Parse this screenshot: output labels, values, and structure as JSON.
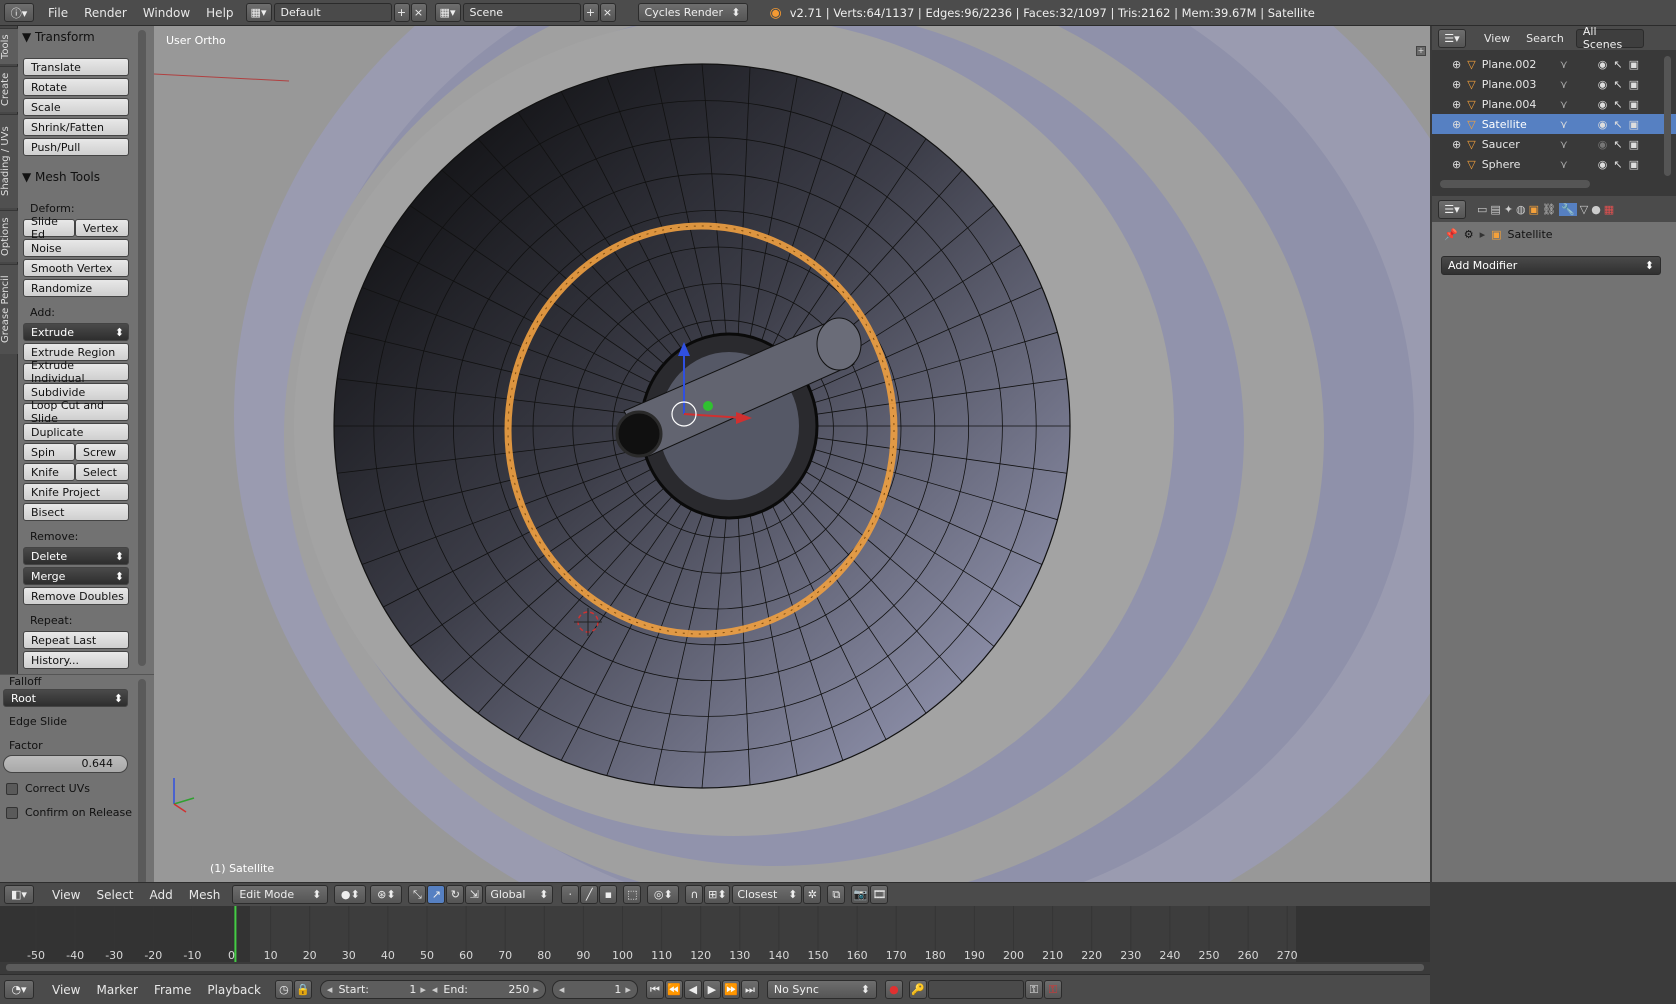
{
  "topbar": {
    "menus": [
      "File",
      "Render",
      "Window",
      "Help"
    ],
    "layout": "Default",
    "scene": "Scene",
    "engine": "Cycles Render",
    "stats": "v2.71 | Verts:64/1137 | Edges:96/2236 | Faces:32/1097 | Tris:2162 | Mem:39.67M | Satellite"
  },
  "tabs": [
    "Tools",
    "Create",
    "Shading / UVs",
    "Options",
    "Grease Pencil"
  ],
  "toolshelf": {
    "transform_title": "Transform",
    "transform": [
      "Translate",
      "Rotate",
      "Scale",
      "Shrink/Fatten",
      "Push/Pull"
    ],
    "meshtools_title": "Mesh Tools",
    "deform_label": "Deform:",
    "slide_edge": "Slide Ed",
    "vertex": "Vertex",
    "noise": "Noise",
    "smooth_vertex": "Smooth Vertex",
    "randomize": "Randomize",
    "add_label": "Add:",
    "extrude": "Extrude",
    "extrude_region": "Extrude Region",
    "extrude_individual": "Extrude Individual",
    "subdivide": "Subdivide",
    "loop_cut": "Loop Cut and Slide",
    "duplicate": "Duplicate",
    "spin": "Spin",
    "screw": "Screw",
    "knife": "Knife",
    "select": "Select",
    "knife_project": "Knife Project",
    "bisect": "Bisect",
    "remove_label": "Remove:",
    "delete": "Delete",
    "merge": "Merge",
    "remove_doubles": "Remove Doubles",
    "repeat_label": "Repeat:",
    "repeat_last": "Repeat Last",
    "history": "History..."
  },
  "operator": {
    "falloff_label": "Falloff",
    "falloff_value": "Root",
    "title": "Edge Slide",
    "factor_label": "Factor",
    "factor_value": "0.644",
    "correct_uvs": "Correct UVs",
    "confirm_release": "Confirm on Release"
  },
  "viewport": {
    "view_label": "User Ortho",
    "object_label": "(1) Satellite"
  },
  "outliner": {
    "view": "View",
    "search": "Search",
    "scenes": "All Scenes",
    "items": [
      "Plane.002",
      "Plane.003",
      "Plane.004",
      "Satellite",
      "Saucer",
      "Sphere"
    ],
    "active": "Satellite"
  },
  "properties": {
    "object_name": "Satellite",
    "add_modifier": "Add Modifier"
  },
  "view3d_header": {
    "view": "View",
    "select": "Select",
    "add": "Add",
    "mesh": "Mesh",
    "mode": "Edit Mode",
    "orientation": "Global",
    "snap": "Closest"
  },
  "timeline": {
    "ticks": [
      -50,
      -40,
      -30,
      -20,
      -10,
      0,
      10,
      20,
      30,
      40,
      50,
      60,
      70,
      80,
      90,
      100,
      110,
      120,
      130,
      140,
      150,
      160,
      170,
      180,
      190,
      200,
      210,
      220,
      230,
      240,
      250,
      260,
      270
    ],
    "current_frame": 1
  },
  "timeline_header": {
    "view": "View",
    "marker": "Marker",
    "frame": "Frame",
    "playback": "Playback",
    "start_label": "Start:",
    "start": "1",
    "end_label": "End:",
    "end": "250",
    "current": "1",
    "sync": "No Sync"
  },
  "colors": {
    "accent_blue": "#5680c2",
    "selection_orange": "#f0a040",
    "frame_green": "#44cc44"
  }
}
